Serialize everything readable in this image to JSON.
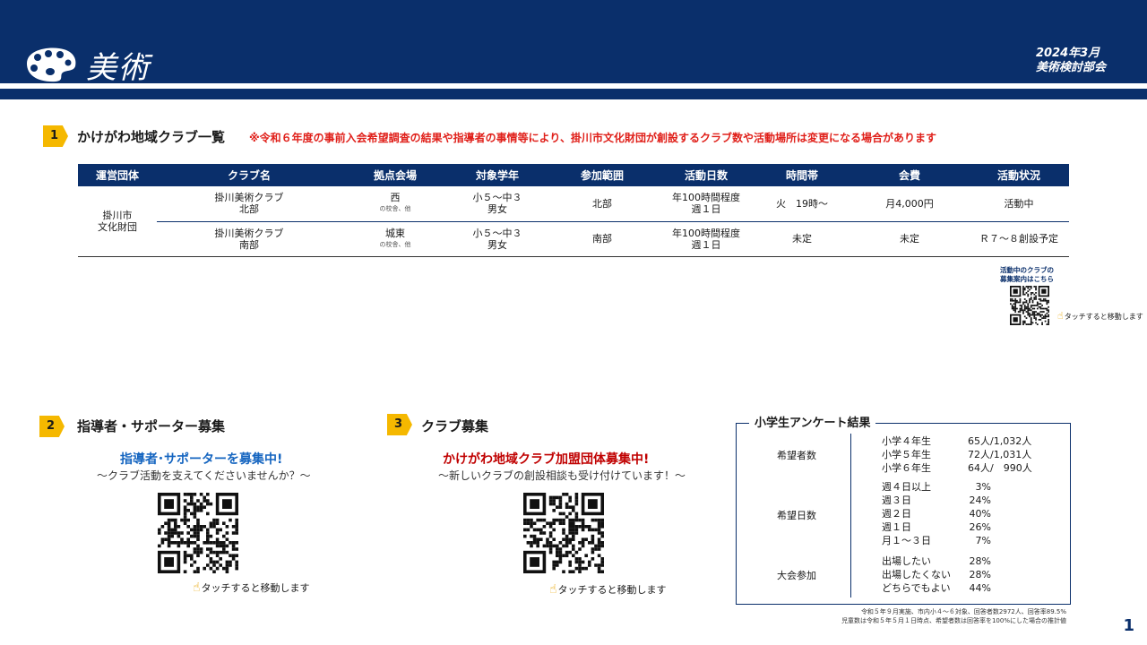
{
  "header": {
    "title": "美術",
    "date": "2024年3月",
    "committee": "美術検討部会"
  },
  "section1": {
    "num": "1",
    "title": "かけがわ地域クラブ一覧",
    "note": "※令和６年度の事前入会希望調査の結果や指導者の事情等により、掛川市文化財団が創設するクラブ数や活動場所は変更になる場合があります",
    "table": {
      "headers": [
        "運営団体",
        "クラブ名",
        "拠点会場",
        "対象学年",
        "参加範囲",
        "活動日数",
        "時間帯",
        "会費",
        "活動状況"
      ],
      "org": [
        "掛川市",
        "文化財団"
      ],
      "rows": [
        {
          "club": [
            "掛川美術クラブ",
            "北部"
          ],
          "venue": "西",
          "venue_sub": "の校舎、他",
          "grade": [
            "小５～中３",
            "男女"
          ],
          "range": "北部",
          "days": [
            "年100時間程度",
            "週１日"
          ],
          "time": "火　19時～",
          "fee": "月4,000円",
          "status": "活動中"
        },
        {
          "club": [
            "掛川美術クラブ",
            "南部"
          ],
          "venue": "城東",
          "venue_sub": "の校舎、他",
          "grade": [
            "小５～中３",
            "男女"
          ],
          "range": "南部",
          "days": [
            "年100時間程度",
            "週１日"
          ],
          "time": "未定",
          "fee": "未定",
          "status": "Ｒ７～８創設予定"
        }
      ]
    },
    "qr_label": [
      "活動中のクラブの",
      "募集案内はこちら"
    ],
    "touch": "タッチすると移動します"
  },
  "section2": {
    "num": "2",
    "title": "指導者・サポーター募集",
    "headline": "指導者･サポーターを募集中!",
    "sub": "～クラブ活動を支えてくださいませんか？～",
    "touch": "タッチすると移動します"
  },
  "section3": {
    "num": "3",
    "title": "クラブ募集",
    "headline": "かけがわ地域クラブ加盟団体募集中!",
    "sub": "～新しいクラブの創設相談も受け付けています！～",
    "touch": "タッチすると移動します"
  },
  "survey": {
    "title": "小学生アンケート結果",
    "groups": [
      {
        "label": "希望者数",
        "rows": [
          [
            "小学４年生",
            "65人/1,032人"
          ],
          [
            "小学５年生",
            "72人/1,031人"
          ],
          [
            "小学６年生",
            "64人/　990人"
          ]
        ]
      },
      {
        "label": "希望日数",
        "rows": [
          [
            "週４日以上",
            "3%"
          ],
          [
            "週３日",
            "24%"
          ],
          [
            "週２日",
            "40%"
          ],
          [
            "週１日",
            "26%"
          ],
          [
            "月１～３日",
            "7%"
          ]
        ]
      },
      {
        "label": "大会参加",
        "rows": [
          [
            "出場したい",
            "28%"
          ],
          [
            "出場したくない",
            "28%"
          ],
          [
            "どちらでもよい",
            "44%"
          ]
        ]
      }
    ],
    "foot1": "令和５年９月実施、市内小４～６対象、回答者数2972人、回答率89.5%",
    "foot2": "児童数は令和５年５月１日時点、希望者数は回答率を100%にした場合の推計値"
  },
  "page_number": "1"
}
